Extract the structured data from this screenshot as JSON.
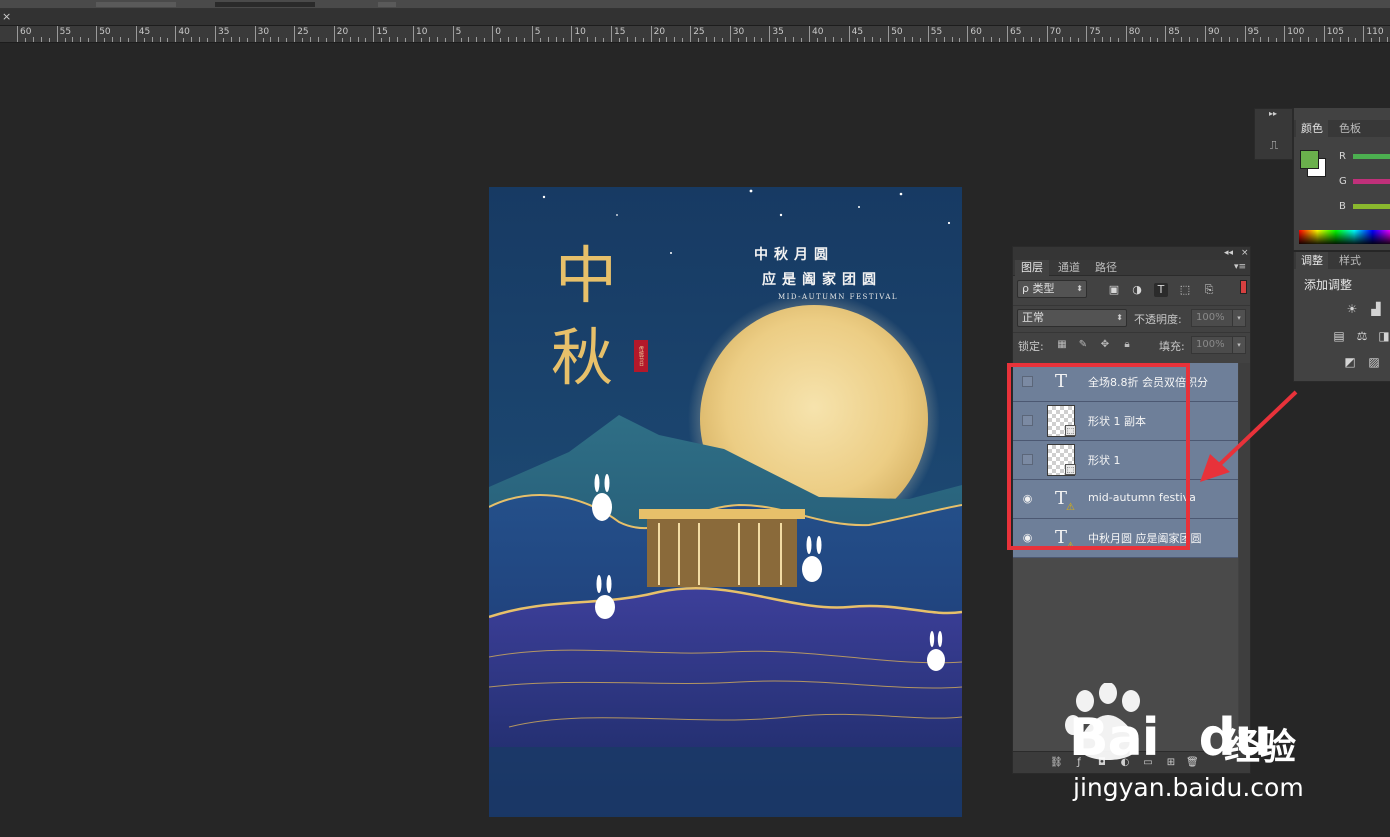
{
  "ruler": {
    "labels": [
      "60",
      "55",
      "50",
      "45",
      "40",
      "35",
      "30",
      "25",
      "20",
      "15",
      "10",
      "5",
      "0",
      "5",
      "10",
      "15",
      "20",
      "25",
      "30",
      "35",
      "40",
      "45",
      "50",
      "55",
      "60",
      "65",
      "70",
      "75",
      "80",
      "85",
      "90",
      "95",
      "100",
      "105",
      "110"
    ]
  },
  "document_tab": {
    "close_glyph": "×"
  },
  "poster": {
    "title_line1": "中秋月圆",
    "title_line2": "应是阖家团圆",
    "subtitle": "MID-AUTUMN FESTIVAL",
    "big_char_1": "中",
    "big_char_2": "秋",
    "seal_text": "传统节日",
    "colors": {
      "sky": "#1b3f66",
      "moon": "#f1d89b",
      "gold": "#e7c06a",
      "mountain_deep": "#1b2f6b"
    }
  },
  "layers_panel": {
    "collapse_glyph": "◂◂",
    "close_glyph": "×",
    "menu_glyph": "▾≡",
    "tabs": [
      {
        "label": "图层",
        "active": true
      },
      {
        "label": "通道",
        "active": false
      },
      {
        "label": "路径",
        "active": false
      }
    ],
    "filter_kind": "ρ 类型",
    "blend_mode": "正常",
    "opacity_label": "不透明度:",
    "opacity_value": "100%",
    "lock_label": "锁定:",
    "fill_label": "填充:",
    "fill_value": "100%",
    "layers": [
      {
        "name": "全场8.8折 会员双倍积分",
        "kind": "text",
        "visible": false,
        "warning": false
      },
      {
        "name": "形状 1 副本",
        "kind": "shape",
        "visible": false,
        "warning": false
      },
      {
        "name": "形状 1",
        "kind": "shape",
        "visible": false,
        "warning": false
      },
      {
        "name": "mid-autumn festiva",
        "kind": "text",
        "visible": true,
        "warning": true
      },
      {
        "name": "中秋月圆 应是阖家团圆",
        "kind": "text",
        "visible": true,
        "warning": true
      }
    ],
    "highlight_color": "#e8323a",
    "row_color": "#6e7f99"
  },
  "color_panel": {
    "tabs": [
      {
        "label": "颜色",
        "active": true
      },
      {
        "label": "色板",
        "active": false
      }
    ],
    "channels": [
      {
        "label": "R",
        "color": "#4caf50"
      },
      {
        "label": "G",
        "color": "#c0307a"
      },
      {
        "label": "B",
        "color": "#8ab82e"
      }
    ],
    "foreground": "#6ab04c",
    "background": "#ffffff"
  },
  "adjustments_panel": {
    "tabs": [
      {
        "label": "调整",
        "active": true
      },
      {
        "label": "样式",
        "active": false
      }
    ],
    "title": "添加调整"
  },
  "watermark": {
    "brand": "Bai",
    "brand_suffix": "du",
    "cn": "经验",
    "url": "jingyan.baidu.com"
  }
}
